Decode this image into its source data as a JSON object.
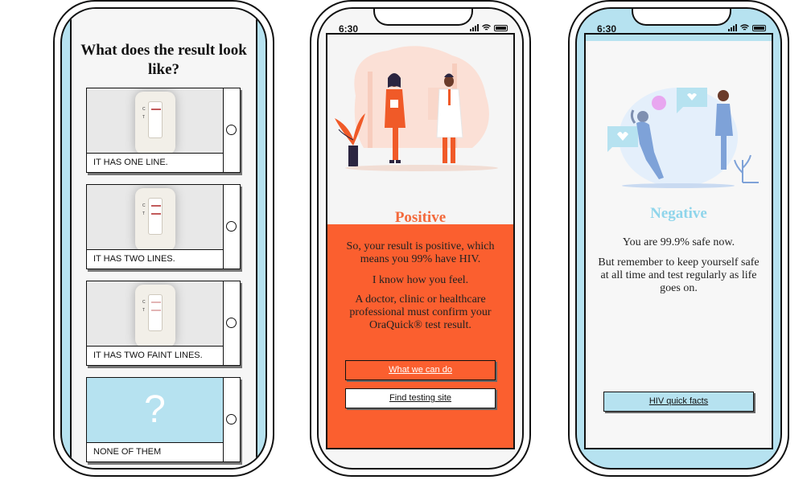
{
  "screens": {
    "result_picker": {
      "title": "What does the result look like?",
      "options": [
        {
          "label": "IT HAS ONE LINE.",
          "strip_marks": [
            "C",
            "T"
          ]
        },
        {
          "label": "IT HAS TWO LINES.",
          "strip_marks": [
            "C",
            "T"
          ]
        },
        {
          "label": "IT HAS TWO FAINT LINES.",
          "strip_marks": [
            "C",
            "T"
          ]
        },
        {
          "label": "NONE OF THEM",
          "glyph": "?"
        }
      ]
    },
    "positive": {
      "status_time": "6:30",
      "title": "Positive",
      "paragraphs": [
        "So, your result is positive, which means you 99% have HIV.",
        "I know how you feel.",
        "A doctor, clinic or healthcare professional must confirm your OraQuick® test result."
      ],
      "primary_button": "What we can do",
      "secondary_button": "Find testing site"
    },
    "negative": {
      "status_time": "6:30",
      "title": "Negative",
      "paragraphs": [
        "You are 99.9% safe now.",
        "But remember to keep yourself safe at all time and test regularly as life goes on."
      ],
      "button": "HIV quick facts"
    }
  },
  "colors": {
    "accent_orange": "#fb5f2f",
    "accent_blue": "#b6e2f0",
    "title_blue": "#8fd5eb"
  }
}
